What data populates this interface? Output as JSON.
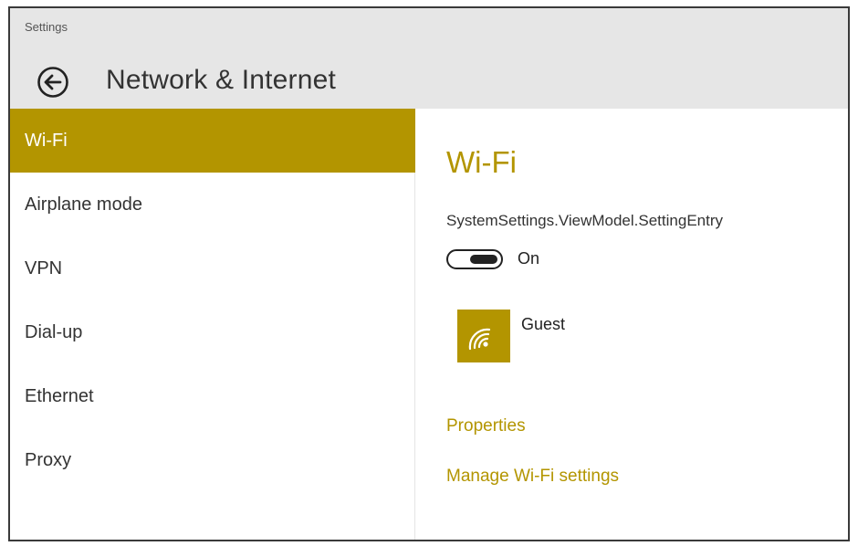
{
  "window": {
    "app_title": "Settings"
  },
  "header": {
    "back_icon": "back-arrow-icon",
    "page_title": "Network & Internet"
  },
  "sidebar": {
    "items": [
      {
        "label": "Wi-Fi",
        "selected": true
      },
      {
        "label": "Airplane mode",
        "selected": false
      },
      {
        "label": "VPN",
        "selected": false
      },
      {
        "label": "Dial-up",
        "selected": false
      },
      {
        "label": "Ethernet",
        "selected": false
      },
      {
        "label": "Proxy",
        "selected": false
      }
    ]
  },
  "main": {
    "section_title": "Wi-Fi",
    "entry_label": "SystemSettings.ViewModel.SettingEntry",
    "toggle": {
      "state_label": "On",
      "on": true
    },
    "network": {
      "name": "Guest",
      "icon": "wifi-signal-icon"
    },
    "links": {
      "properties": "Properties",
      "manage": "Manage Wi-Fi settings"
    }
  },
  "colors": {
    "accent": "#b39500",
    "header_bg": "#e6e6e6",
    "text": "#333333"
  }
}
